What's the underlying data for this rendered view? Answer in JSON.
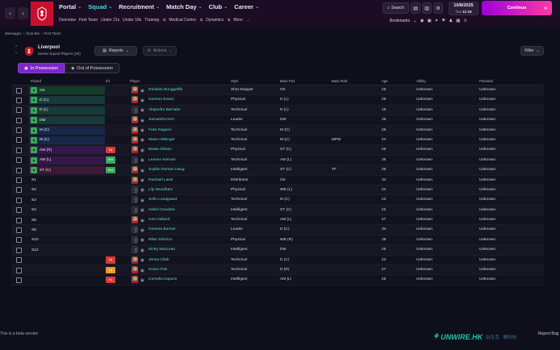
{
  "topbar": {
    "main_menu": [
      {
        "label": "Portal",
        "active": false
      },
      {
        "label": "Squad",
        "active": true
      },
      {
        "label": "Recruitment",
        "active": false
      },
      {
        "label": "Match Day",
        "active": false
      },
      {
        "label": "Club",
        "active": false
      },
      {
        "label": "Career",
        "active": false
      }
    ],
    "sub_menu": [
      "Overview",
      "First Team",
      "Under 21s",
      "Under 18s",
      "Training",
      "Medical Centre",
      "Dynamics",
      "More"
    ],
    "search_label": "Search",
    "date": "10/8/2025",
    "day": "Tue",
    "time": "11:15",
    "continue_label": "Continue",
    "bookmarks_label": "Bookmarks",
    "accent": "#c8102e"
  },
  "breadcrumb": [
    "Messages",
    "Club Bio",
    "First Team"
  ],
  "club": {
    "name": "Liverpool",
    "subtitle": "Senior Squad Players (20)"
  },
  "buttons": {
    "reports": "Reports",
    "actions": "Actions",
    "filter": "Filter"
  },
  "tabs": [
    {
      "label": "In Possession",
      "active": true
    },
    {
      "label": "Out of Possession",
      "active": false
    }
  ],
  "table": {
    "headers": {
      "picked": "Picked",
      "inf": "Inf",
      "player": "Player",
      "style": "Style",
      "base_pos": "Base Pos",
      "base_role": "Base Role",
      "age": "Age",
      "ability": "Ability",
      "potential": "Potential"
    },
    "rows": [
      {
        "pos": "GK",
        "pos_color": "#3aa85a",
        "row_color": "#163a28",
        "inf": "",
        "inf_color": "",
        "face": true,
        "player": "Roñaldo Bunggrtiffe",
        "style": "Shot Stopper",
        "base_pos": "GK",
        "base_role": "",
        "age": "25",
        "ability": "Unknown",
        "potential": "Unknown"
      },
      {
        "pos": "D (C)",
        "pos_color": "#3aa85a",
        "row_color": "#163a38",
        "inf": "",
        "inf_color": "",
        "face": true,
        "player": "Gemmo Evans",
        "style": "Physical",
        "base_pos": "D (L)",
        "base_role": "",
        "age": "29",
        "ability": "Unknown",
        "potential": "Unknown"
      },
      {
        "pos": "D (L)",
        "pos_color": "#3aa85a",
        "row_color": "#163a38",
        "inf": "",
        "inf_color": "",
        "face": false,
        "player": "Alejandro Barnabe",
        "style": "Technical",
        "base_pos": "D (L)",
        "base_role": "",
        "age": "19",
        "ability": "Unknown",
        "potential": "Unknown"
      },
      {
        "pos": "DM",
        "pos_color": "#3aa85a",
        "row_color": "#163a38",
        "inf": "",
        "inf_color": "",
        "face": true,
        "player": "Samantha Kerr",
        "style": "Leader",
        "base_pos": "DM",
        "base_role": "",
        "age": "26",
        "ability": "Unknown",
        "potential": "Unknown"
      },
      {
        "pos": "M (C)",
        "pos_color": "#3aa85a",
        "row_color": "#18284a",
        "inf": "",
        "inf_color": "",
        "face": true,
        "player": "Fuko Nagano",
        "style": "Technical",
        "base_pos": "M (C)",
        "base_role": "",
        "age": "26",
        "ability": "Unknown",
        "potential": "Unknown"
      },
      {
        "pos": "M (C)",
        "pos_color": "#3aa85a",
        "row_color": "#18284a",
        "inf": "",
        "inf_color": "",
        "face": true,
        "player": "Marie Höbinger",
        "style": "Technical",
        "base_pos": "M (C)",
        "base_role": "MPM",
        "age": "24",
        "ability": "Unknown",
        "potential": "Unknown"
      },
      {
        "pos": "AM (R)",
        "pos_color": "#3aa85a",
        "row_color": "#34184a",
        "inf": "Inj",
        "inf_color": "#d83a3a",
        "face": true,
        "player": "Beata Olsson",
        "style": "Physical",
        "base_pos": "ST (C)",
        "base_role": "",
        "age": "26",
        "ability": "Unknown",
        "potential": "Unknown"
      },
      {
        "pos": "AM (L)",
        "pos_color": "#3aa85a",
        "row_color": "#34184a",
        "inf": "Wnt",
        "inf_color": "#3aa85a",
        "face": false,
        "player": "Leanne Kiernan",
        "style": "Technical",
        "base_pos": "AM (L)",
        "base_role": "",
        "age": "26",
        "ability": "Unknown",
        "potential": "Unknown"
      },
      {
        "pos": "ST (C)",
        "pos_color": "#3aa85a",
        "row_color": "#3a1838",
        "inf": "Wnt",
        "inf_color": "#3aa85a",
        "face": true,
        "player": "Sophie Roman Haug",
        "style": "Intelligent",
        "base_pos": "ST (C)",
        "base_role": "TF",
        "age": "26",
        "ability": "Unknown",
        "potential": "Unknown"
      },
      {
        "pos": "S1",
        "pos_color": "",
        "row_color": "",
        "inf": "",
        "inf_color": "",
        "face": true,
        "player": "Rachael Laws",
        "style": "Distributor",
        "base_pos": "GK",
        "base_role": "",
        "age": "34",
        "ability": "Unknown",
        "potential": "Unknown"
      },
      {
        "pos": "S2",
        "pos_color": "",
        "row_color": "",
        "inf": "",
        "inf_color": "",
        "face": false,
        "player": "Lily Woodham",
        "style": "Physical",
        "base_pos": "WB (L)",
        "base_role": "",
        "age": "24",
        "ability": "Unknown",
        "potential": "Unknown"
      },
      {
        "pos": "S3",
        "pos_color": "",
        "row_color": "",
        "inf": "",
        "inf_color": "",
        "face": false,
        "player": "Sofie Lundgaard",
        "style": "Technical",
        "base_pos": "M (C)",
        "base_role": "",
        "age": "23",
        "ability": "Unknown",
        "potential": "Unknown"
      },
      {
        "pos": "S4",
        "pos_color": "",
        "row_color": "",
        "inf": "",
        "inf_color": "",
        "face": false,
        "player": "Isobel Goodwin",
        "style": "Intelligent",
        "base_pos": "ST (C)",
        "base_role": "",
        "age": "22",
        "ability": "Unknown",
        "potential": "Unknown"
      },
      {
        "pos": "S5",
        "pos_color": "",
        "row_color": "",
        "inf": "",
        "inf_color": "",
        "face": true,
        "player": "Ceri Holland",
        "style": "Technical",
        "base_pos": "AM (L)",
        "base_role": "",
        "age": "27",
        "ability": "Unknown",
        "potential": "Unknown"
      },
      {
        "pos": "S6",
        "pos_color": "",
        "row_color": "",
        "inf": "",
        "inf_color": "",
        "face": false,
        "player": "Gemma Bonner",
        "style": "Leader",
        "base_pos": "D (C)",
        "base_role": "",
        "age": "34",
        "ability": "Unknown",
        "potential": "Unknown"
      },
      {
        "pos": "S10",
        "pos_color": "",
        "row_color": "",
        "inf": "",
        "inf_color": "",
        "face": false,
        "player": "Rilao Shimizu",
        "style": "Physical",
        "base_pos": "WB (R)",
        "base_role": "",
        "age": "29",
        "ability": "Unknown",
        "potential": "Unknown"
      },
      {
        "pos": "S12",
        "pos_color": "",
        "row_color": "",
        "inf": "",
        "inf_color": "",
        "face": false,
        "player": "Kirsty MacLean",
        "style": "Intelligent",
        "base_pos": "DM",
        "base_role": "",
        "age": "25",
        "ability": "Unknown",
        "potential": "Unknown"
      },
      {
        "pos": "",
        "pos_color": "",
        "row_color": "",
        "inf": "Inj",
        "inf_color": "#d83a3a",
        "face": true,
        "player": "Jenna Clark",
        "style": "Technical",
        "base_pos": "D (C)",
        "base_role": "",
        "age": "23",
        "ability": "Unknown",
        "potential": "Unknown"
      },
      {
        "pos": "",
        "pos_color": "",
        "row_color": "",
        "inf": "Inj",
        "inf_color": "#e89a2a",
        "face": true,
        "player": "Grace Fisk",
        "style": "Technical",
        "base_pos": "D (R)",
        "base_role": "",
        "age": "27",
        "ability": "Unknown",
        "potential": "Unknown"
      },
      {
        "pos": "",
        "pos_color": "",
        "row_color": "",
        "inf": "Inj",
        "inf_color": "#d83a3a",
        "face": true,
        "player": "Cornelia Kapocs",
        "style": "Intelligent",
        "base_pos": "AM (L)",
        "base_role": "",
        "age": "25",
        "ability": "Unknown",
        "potential": "Unknown"
      }
    ]
  },
  "footer": {
    "beta": "This is a beta version",
    "report_bug": "Report Bug",
    "watermark": "UNWIRE.HK",
    "watermark_cn": "玩生活 · 樂科技"
  }
}
